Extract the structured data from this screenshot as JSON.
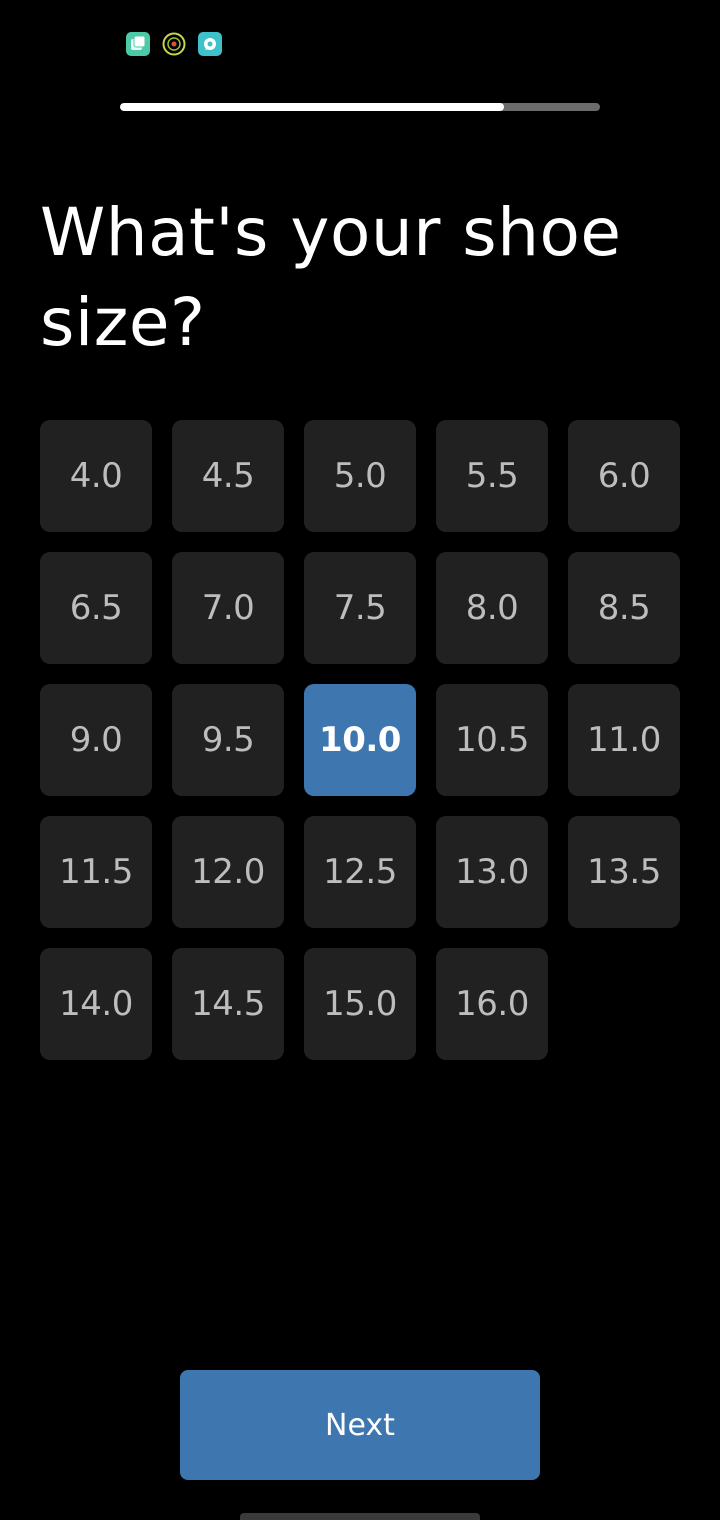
{
  "status_bar": {
    "icons": [
      "photo-app-icon",
      "target-app-icon",
      "chat-app-icon"
    ]
  },
  "progress": {
    "fraction": 0.8,
    "fill_color": "#ffffff",
    "track_color": "#6b6b6b"
  },
  "question": {
    "title": "What's your shoe size?"
  },
  "sizes": {
    "options": [
      "4.0",
      "4.5",
      "5.0",
      "5.5",
      "6.0",
      "6.5",
      "7.0",
      "7.5",
      "8.0",
      "8.5",
      "9.0",
      "9.5",
      "10.0",
      "10.5",
      "11.0",
      "11.5",
      "12.0",
      "12.5",
      "13.0",
      "13.5",
      "14.0",
      "14.5",
      "15.0",
      "16.0"
    ],
    "selected": "10.0"
  },
  "actions": {
    "next_label": "Next"
  },
  "colors": {
    "accent": "#3e77b0",
    "tile": "#212121",
    "background": "#000000"
  }
}
